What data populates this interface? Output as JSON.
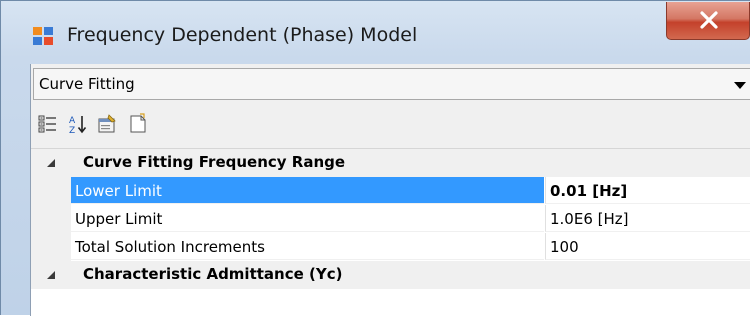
{
  "window": {
    "title": "Frequency Dependent (Phase) Model",
    "close_symbol": "X"
  },
  "combo": {
    "selected": "Curve Fitting"
  },
  "toolbar": {
    "buttons": [
      {
        "name": "categorized-icon"
      },
      {
        "name": "alphabetical-sort-icon"
      },
      {
        "name": "property-pages-icon"
      },
      {
        "name": "events-icon"
      }
    ]
  },
  "grid": {
    "category1": "Curve Fitting Frequency Range",
    "rows": [
      {
        "name": "Lower Limit",
        "value": "0.01 [Hz]"
      },
      {
        "name": "Upper Limit",
        "value": "1.0E6 [Hz]"
      },
      {
        "name": "Total Solution Increments",
        "value": "100"
      }
    ],
    "category2": "Characteristic Admittance (Yc)"
  },
  "colors": {
    "selection": "#3399ff",
    "close_button": "#c4412b"
  }
}
